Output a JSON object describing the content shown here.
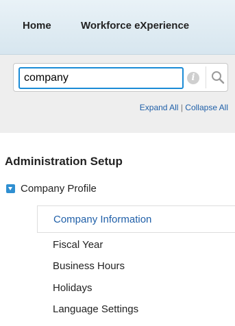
{
  "nav": {
    "tabs": [
      "Home",
      "Workforce eXperience"
    ]
  },
  "search": {
    "value": "company",
    "expand_all": "Expand All",
    "separator": "|",
    "collapse_all": "Collapse All"
  },
  "setup": {
    "title": "Administration Setup",
    "parent": "Company Profile",
    "selected": "Company Information",
    "items": [
      "Fiscal Year",
      "Business Hours",
      "Holidays",
      "Language Settings"
    ]
  },
  "colors": {
    "accent": "#2f8fd1",
    "link": "#1f5fa8",
    "input_focus_border": "#1a8bd6"
  },
  "icons": {
    "info": "info-icon",
    "search": "search-icon",
    "toggle": "collapse-toggle-icon"
  }
}
